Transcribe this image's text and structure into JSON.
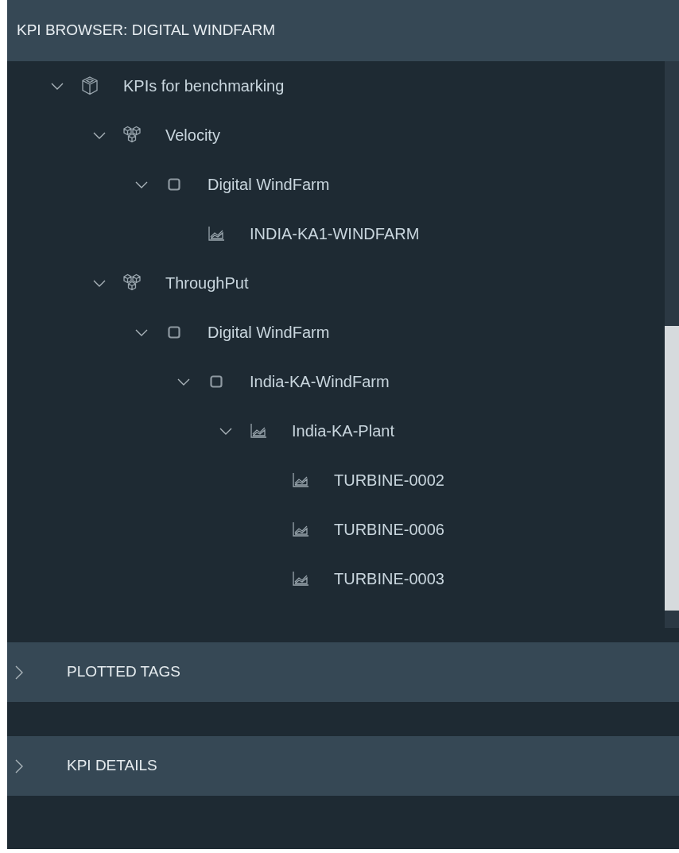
{
  "header": {
    "title": "KPI BROWSER: DIGITAL WINDFARM"
  },
  "tree": [
    {
      "label": "KPIs for benchmarking",
      "kind": "cube",
      "expanded": true,
      "children": [
        {
          "label": "Velocity",
          "kind": "cubes",
          "expanded": true,
          "children": [
            {
              "label": "Digital WindFarm",
              "kind": "square",
              "expanded": true,
              "children": [
                {
                  "label": "INDIA-KA1-WINDFARM",
                  "kind": "chart"
                }
              ]
            }
          ]
        },
        {
          "label": "ThroughPut",
          "kind": "cubes",
          "expanded": true,
          "children": [
            {
              "label": "Digital WindFarm",
              "kind": "square",
              "expanded": true,
              "children": [
                {
                  "label": "India-KA-WindFarm",
                  "kind": "square",
                  "expanded": true,
                  "children": [
                    {
                      "label": "India-KA-Plant",
                      "kind": "chart",
                      "expanded": true,
                      "children": [
                        {
                          "label": "TURBINE-0002",
                          "kind": "chart"
                        },
                        {
                          "label": "TURBINE-0006",
                          "kind": "chart"
                        },
                        {
                          "label": "TURBINE-0003",
                          "kind": "chart"
                        }
                      ]
                    }
                  ]
                }
              ]
            }
          ]
        }
      ]
    }
  ],
  "sections": [
    {
      "title": "PLOTTED TAGS",
      "expanded": false
    },
    {
      "title": "KPI DETAILS",
      "expanded": false
    }
  ]
}
